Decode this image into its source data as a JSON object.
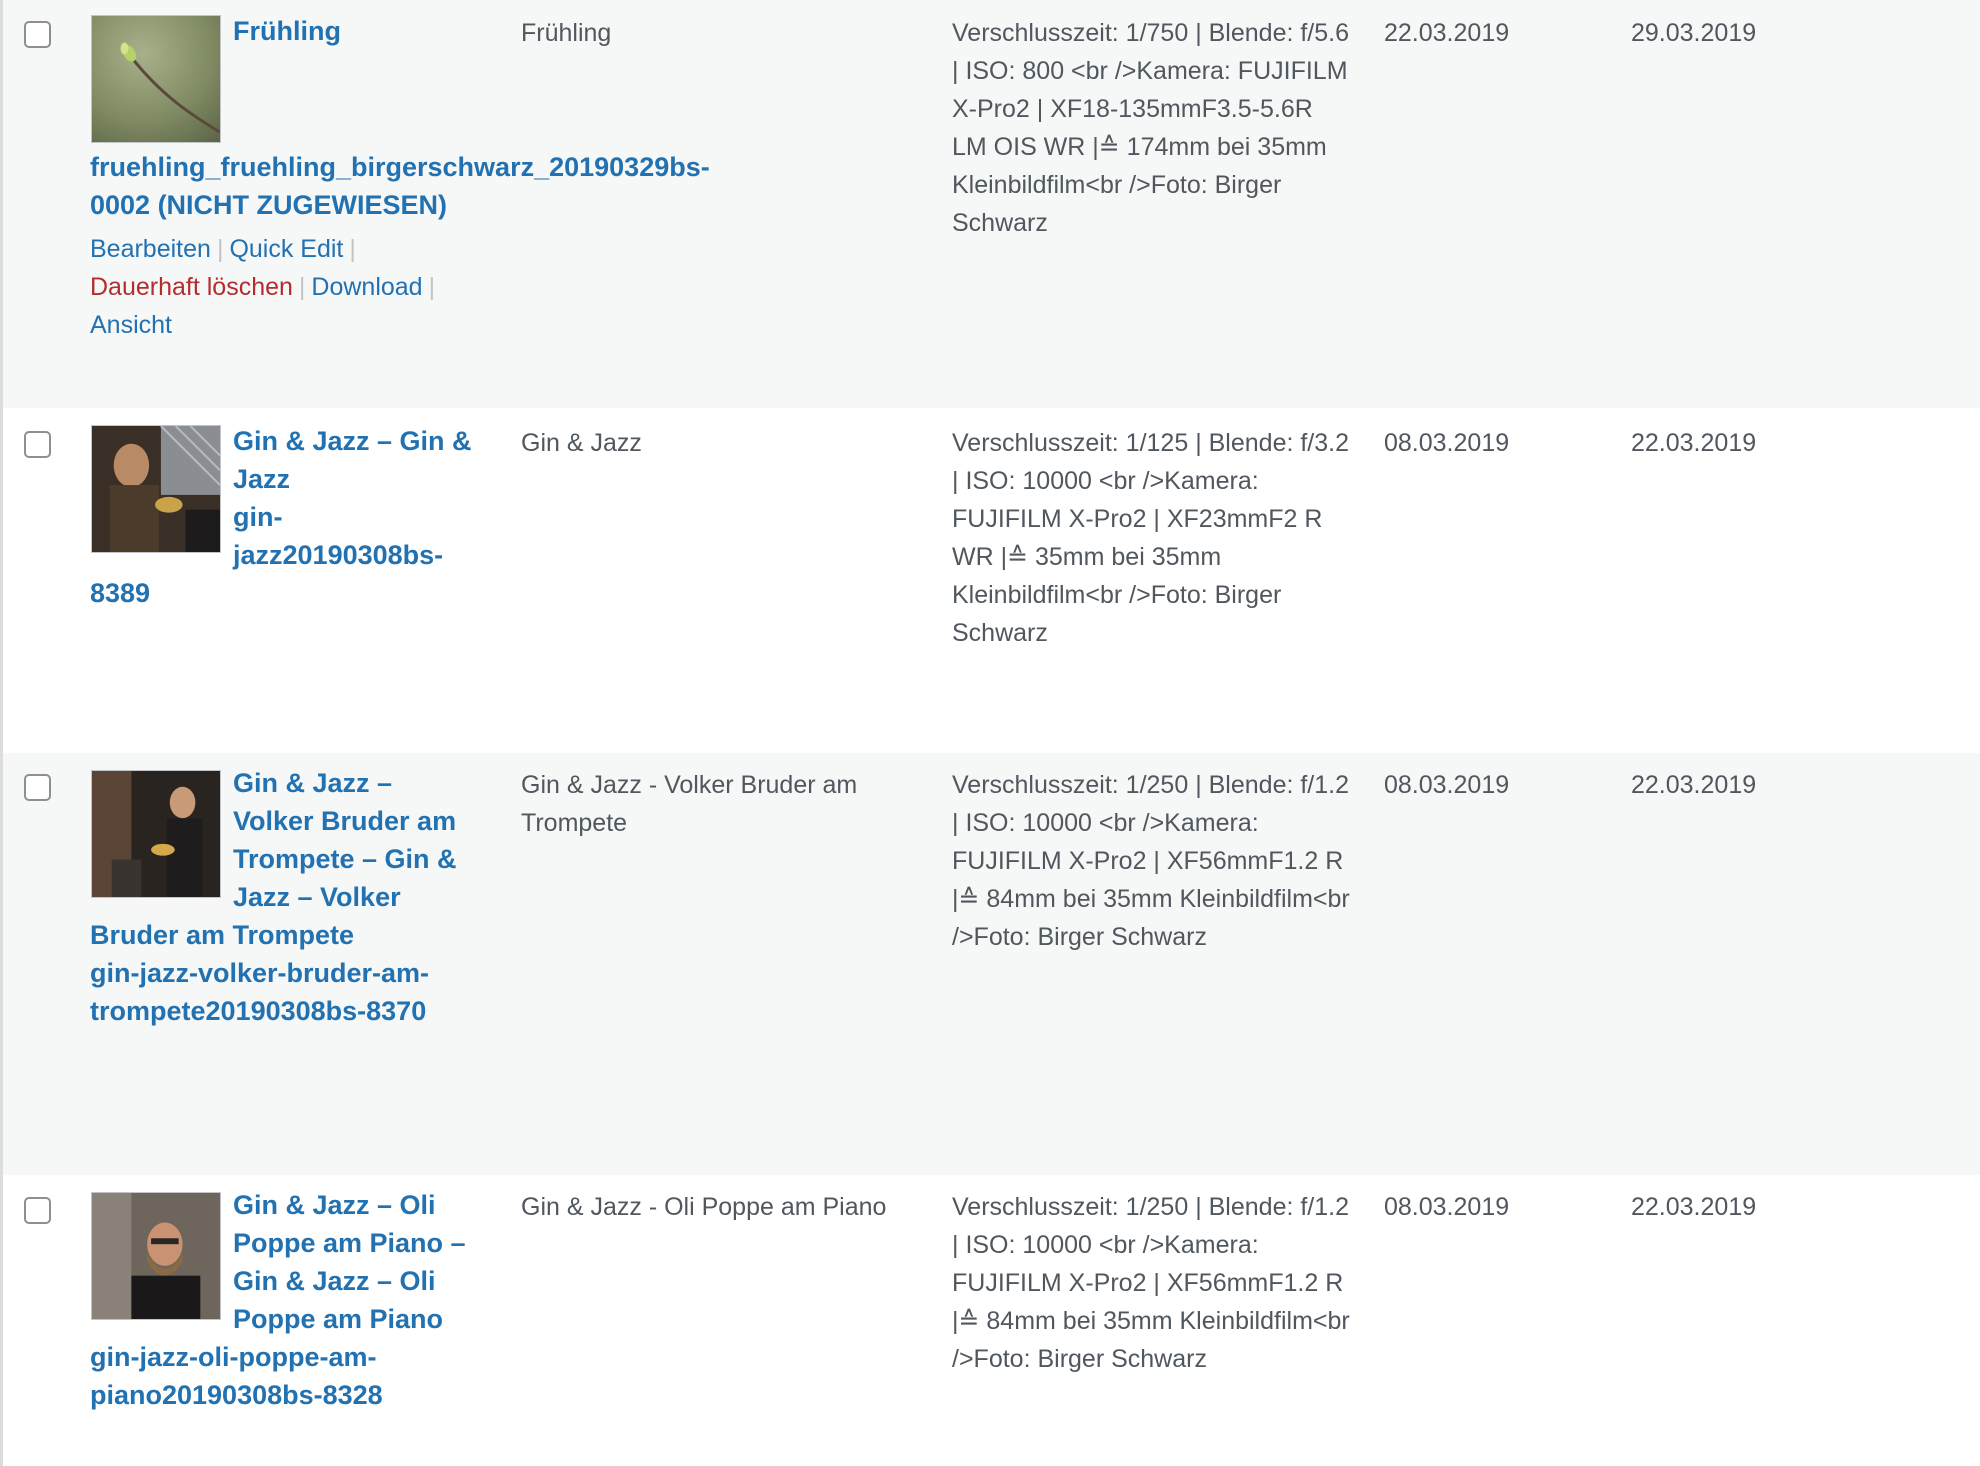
{
  "rows": [
    {
      "title": "Frühling",
      "filename": "fruehling_fruehling_birgerschwarz_20190329bs-0002 (NICHT ZUGEWIESEN)",
      "alt": "Frühling",
      "description": "Verschlusszeit: 1/750 | Blende: f/5.6 | ISO: 800 <br />Kamera: FUJIFILM X-Pro2 | XF18-135mmF3.5-5.6R LM OIS WR |≙ 174mm bei 35mm Kleinbildfilm<br />Foto: Birger Schwarz",
      "date1": "22.03.2019",
      "date2": "29.03.2019",
      "thumb": "spring-branch-photo",
      "actions": {
        "edit": "Bearbeiten",
        "quick_edit": "Quick Edit",
        "delete": "Dauerhaft löschen",
        "download": "Download",
        "view": "Ansicht",
        "separator": "|"
      }
    },
    {
      "title": "Gin & Jazz – Gin & Jazz",
      "filename": "gin-jazz20190308bs-8389",
      "alt": "Gin & Jazz",
      "description": "Verschlusszeit: 1/125 | Blende: f/3.2 | ISO: 10000 <br />Kamera: FUJIFILM X-Pro2 | XF23mmF2 R WR |≙ 35mm bei 35mm Kleinbildfilm<br />Foto: Birger Schwarz",
      "date1": "08.03.2019",
      "date2": "22.03.2019",
      "thumb": "jazz-band-photo"
    },
    {
      "title": "Gin & Jazz – Volker Bruder am Trompete – Gin & Jazz – Volker Bruder am Trompete",
      "filename": "gin-jazz-volker-bruder-am-trompete20190308bs-8370",
      "alt": "Gin & Jazz - Volker Bruder am Trompete",
      "description": "Verschlusszeit: 1/250 | Blende: f/1.2 | ISO: 10000 <br />Kamera: FUJIFILM X-Pro2 | XF56mmF1.2 R |≙ 84mm bei 35mm Kleinbildfilm<br />Foto: Birger Schwarz",
      "date1": "08.03.2019",
      "date2": "22.03.2019",
      "thumb": "trumpet-player-photo"
    },
    {
      "title": "Gin & Jazz – Oli Poppe am Piano – Gin & Jazz – Oli Poppe am Piano",
      "filename": "gin-jazz-oli-poppe-am-piano20190308bs-8328",
      "alt": "Gin & Jazz - Oli Poppe am Piano",
      "description": "Verschlusszeit: 1/250 | Blende: f/1.2 | ISO: 10000 <br />Kamera: FUJIFILM X-Pro2 | XF56mmF1.2 R |≙ 84mm bei 35mm Kleinbildfilm<br />Foto: Birger Schwarz",
      "date1": "08.03.2019",
      "date2": "22.03.2019",
      "thumb": "pianist-portrait-photo"
    }
  ]
}
